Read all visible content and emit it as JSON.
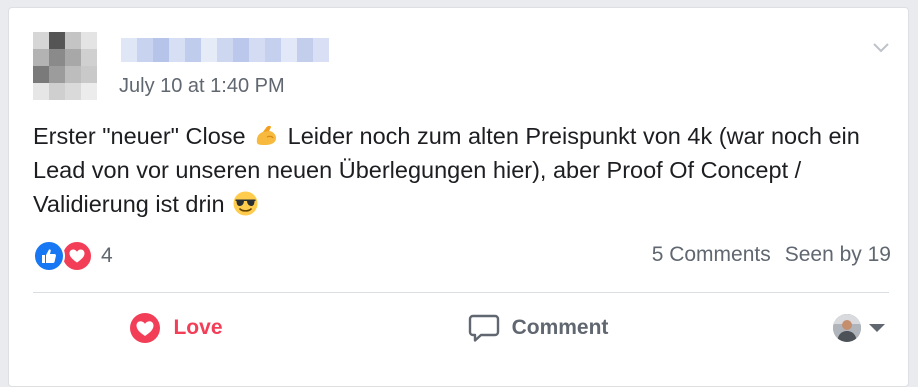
{
  "post": {
    "author_name": "",
    "timestamp": "July 10 at 1:40 PM",
    "text_part1": "Erster \"neuer\" Close",
    "text_part2": "Leider noch zum alten Preispunkt von 4k (war noch ein Lead von vor unseren neuen Überlegungen hier), aber Proof Of Concept / Validierung ist drin",
    "emojis": [
      "flexed-biceps",
      "smiling-face-with-sunglasses"
    ]
  },
  "stats": {
    "reaction_types": [
      "like",
      "love"
    ],
    "reaction_count": "4",
    "comments_label": "5 Comments",
    "seen_label": "Seen by 19"
  },
  "actions": {
    "love_label": "Love",
    "comment_label": "Comment"
  },
  "colors": {
    "love_red": "#f33e58",
    "like_blue": "#1877f2",
    "meta_gray": "#606770",
    "text": "#1c1e21"
  }
}
